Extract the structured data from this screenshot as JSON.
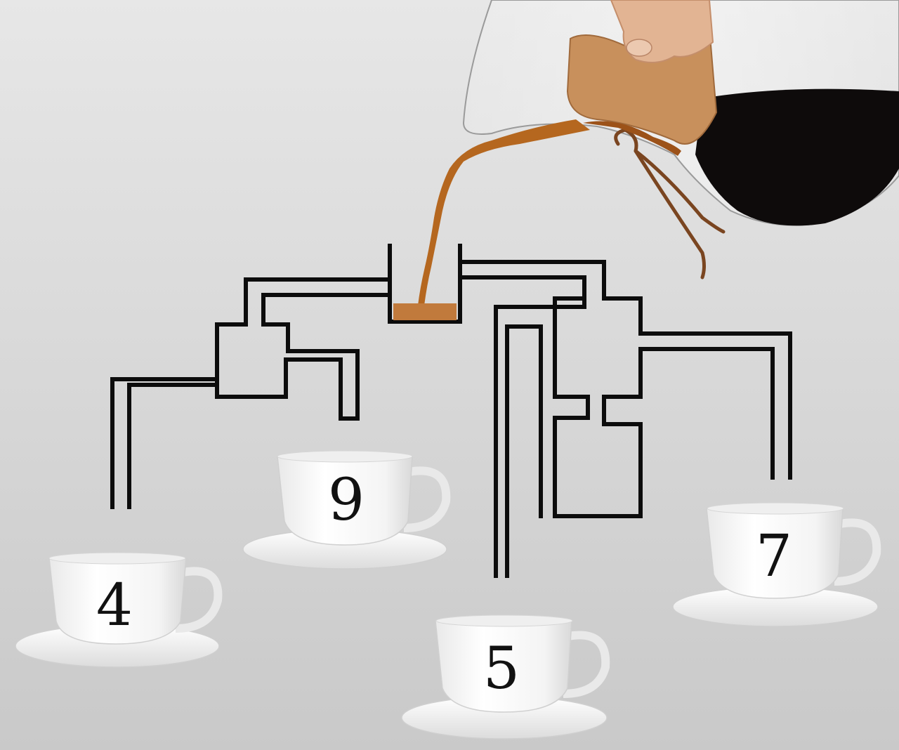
{
  "colors": {
    "background_top": "#e6e6e6",
    "background_bottom": "#cbcbcb",
    "pipe": "#0c0c0c",
    "coffee": "#b5671f",
    "coffee_dark": "#0e0b0b",
    "cork": "#c8905c",
    "skin": "#e2b493",
    "cup": "#fdfdfd",
    "cup_shadow": "#d4d4d4"
  },
  "cups": [
    {
      "id": "cup-4",
      "number": "4"
    },
    {
      "id": "cup-9",
      "number": "9"
    },
    {
      "id": "cup-5",
      "number": "5"
    },
    {
      "id": "cup-7",
      "number": "7"
    }
  ],
  "icons": [
    "hand-icon",
    "coffee-carafe-icon",
    "coffee-stream-icon",
    "funnel-icon"
  ]
}
